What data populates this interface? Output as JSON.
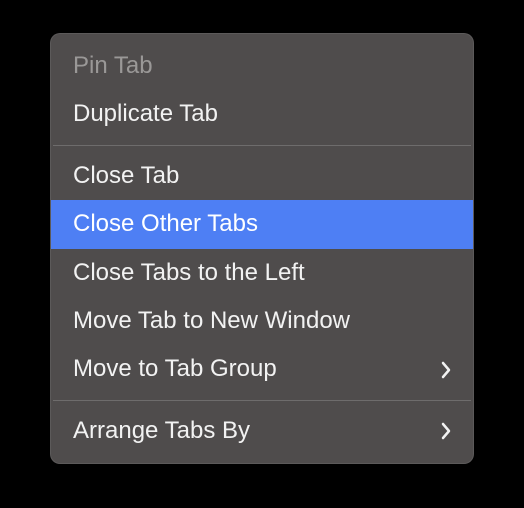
{
  "menu": {
    "items": [
      {
        "label": "Pin Tab",
        "disabled": true,
        "submenu": false
      },
      {
        "label": "Duplicate Tab",
        "disabled": false,
        "submenu": false
      }
    ],
    "items2": [
      {
        "label": "Close Tab",
        "disabled": false,
        "submenu": false
      },
      {
        "label": "Close Other Tabs",
        "disabled": false,
        "submenu": false,
        "highlighted": true
      },
      {
        "label": "Close Tabs to the Left",
        "disabled": false,
        "submenu": false
      },
      {
        "label": "Move Tab to New Window",
        "disabled": false,
        "submenu": false
      },
      {
        "label": "Move to Tab Group",
        "disabled": false,
        "submenu": true
      }
    ],
    "items3": [
      {
        "label": "Arrange Tabs By",
        "disabled": false,
        "submenu": true
      }
    ]
  },
  "colors": {
    "highlight": "#4e7ff4",
    "menu_bg": "#4f4c4c",
    "text": "#f2f2f2",
    "disabled_text": "#9a9897"
  }
}
